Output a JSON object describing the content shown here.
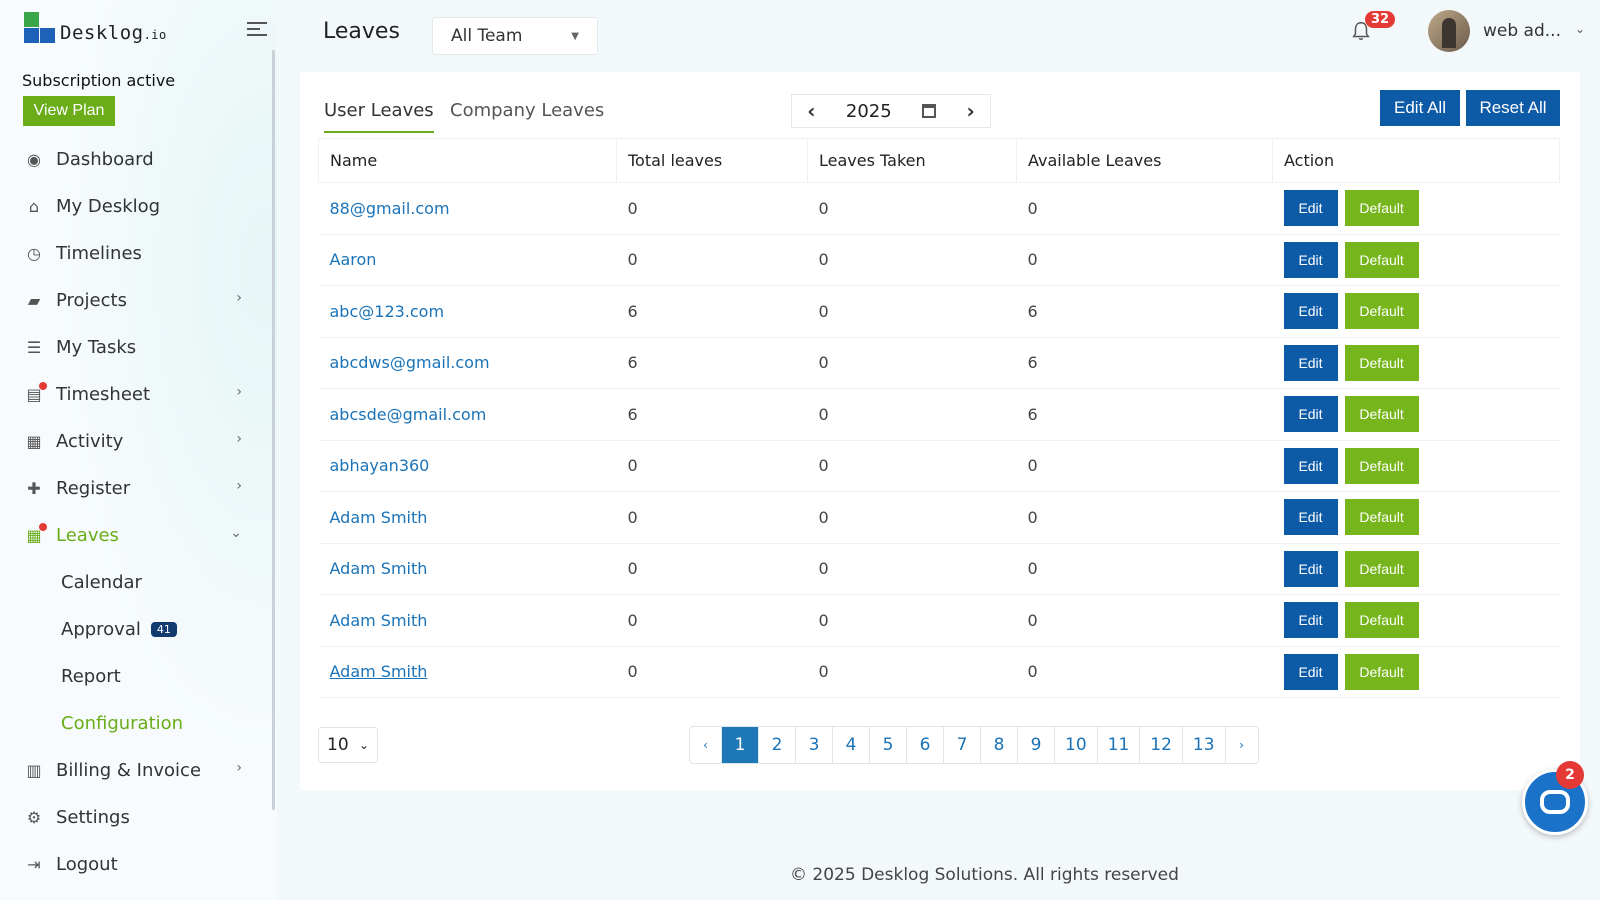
{
  "brand": {
    "name": "Desklog",
    "suffix": ".io"
  },
  "subscription": {
    "status": "Subscription active",
    "view_plan": "View Plan"
  },
  "nav": [
    {
      "label": "Dashboard",
      "icon": "dashboard-icon"
    },
    {
      "label": "My Desklog",
      "icon": "home-icon"
    },
    {
      "label": "Timelines",
      "icon": "clock-icon"
    },
    {
      "label": "Projects",
      "icon": "book-icon"
    },
    {
      "label": "My Tasks",
      "icon": "tasks-icon"
    },
    {
      "label": "Timesheet",
      "icon": "timesheet-icon"
    },
    {
      "label": "Activity",
      "icon": "grid-icon"
    },
    {
      "label": "Register",
      "icon": "plus-icon"
    },
    {
      "label": "Leaves",
      "icon": "calendar-icon"
    }
  ],
  "leaves_sub": [
    {
      "label": "Calendar"
    },
    {
      "label": "Approval",
      "badge": "41"
    },
    {
      "label": "Report"
    },
    {
      "label": "Configuration"
    }
  ],
  "nav_bottom": [
    {
      "label": "Billing & Invoice",
      "icon": "invoice-icon"
    },
    {
      "label": "Settings",
      "icon": "gear-icon"
    },
    {
      "label": "Logout",
      "icon": "logout-icon"
    }
  ],
  "header": {
    "title": "Leaves",
    "team_select": "All Team",
    "notifications": "32",
    "user": "web ad..."
  },
  "tabs": {
    "user": "User Leaves",
    "company": "Company Leaves"
  },
  "year": "2025",
  "actions": {
    "edit_all": "Edit All",
    "reset_all": "Reset All"
  },
  "table": {
    "columns": [
      "Name",
      "Total leaves",
      "Leaves Taken",
      "Available Leaves",
      "Action"
    ],
    "edit_label": "Edit",
    "default_label": "Default",
    "rows": [
      {
        "name": "88@gmail.com",
        "total": "0",
        "taken": "0",
        "available": "0"
      },
      {
        "name": "Aaron",
        "total": "0",
        "taken": "0",
        "available": "0"
      },
      {
        "name": "abc@123.com",
        "total": "6",
        "taken": "0",
        "available": "6"
      },
      {
        "name": "abcdws@gmail.com",
        "total": "6",
        "taken": "0",
        "available": "6"
      },
      {
        "name": "abcsde@gmail.com",
        "total": "6",
        "taken": "0",
        "available": "6"
      },
      {
        "name": "abhayan360",
        "total": "0",
        "taken": "0",
        "available": "0"
      },
      {
        "name": "Adam Smith",
        "total": "0",
        "taken": "0",
        "available": "0"
      },
      {
        "name": "Adam Smith",
        "total": "0",
        "taken": "0",
        "available": "0"
      },
      {
        "name": "Adam Smith",
        "total": "0",
        "taken": "0",
        "available": "0"
      },
      {
        "name": "Adam Smith",
        "total": "0",
        "taken": "0",
        "available": "0"
      }
    ]
  },
  "pagination": {
    "page_size": "10",
    "prev": "‹",
    "next": "›",
    "pages": [
      "1",
      "2",
      "3",
      "4",
      "5",
      "6",
      "7",
      "8",
      "9",
      "10",
      "11",
      "12",
      "13"
    ],
    "current": "1"
  },
  "footer": "© 2025 Desklog Solutions. All rights reserved",
  "chat": {
    "badge": "2"
  },
  "colors": {
    "brand_green": "#6aad19",
    "brand_blue": "#0d5aa7",
    "link": "#1a73b8",
    "alert": "#e53935"
  }
}
